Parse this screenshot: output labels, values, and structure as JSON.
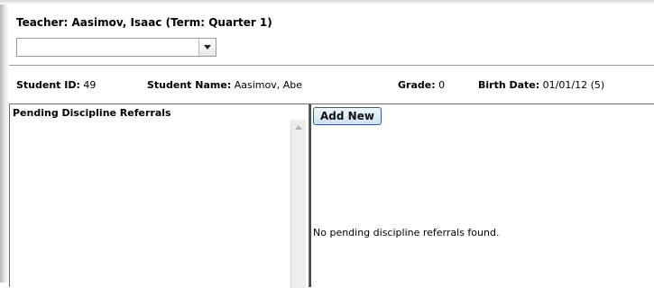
{
  "header": {
    "teacher_title": "Teacher: Aasimov, Isaac (Term: Quarter 1)",
    "selector_value": ""
  },
  "student": {
    "id_label": "Student ID:",
    "id_value": "49",
    "name_label": "Student Name:",
    "name_value": "Aasimov, Abe",
    "grade_label": "Grade:",
    "grade_value": "0",
    "birth_label": "Birth Date:",
    "birth_value": "01/01/12 (5)"
  },
  "referrals": {
    "title": "Pending Discipline Referrals",
    "add_new_label": "Add New",
    "empty_message": "No pending discipline referrals found."
  },
  "colors": {
    "button_border": "#2f5f98",
    "button_fill": "#cbe0f6"
  }
}
